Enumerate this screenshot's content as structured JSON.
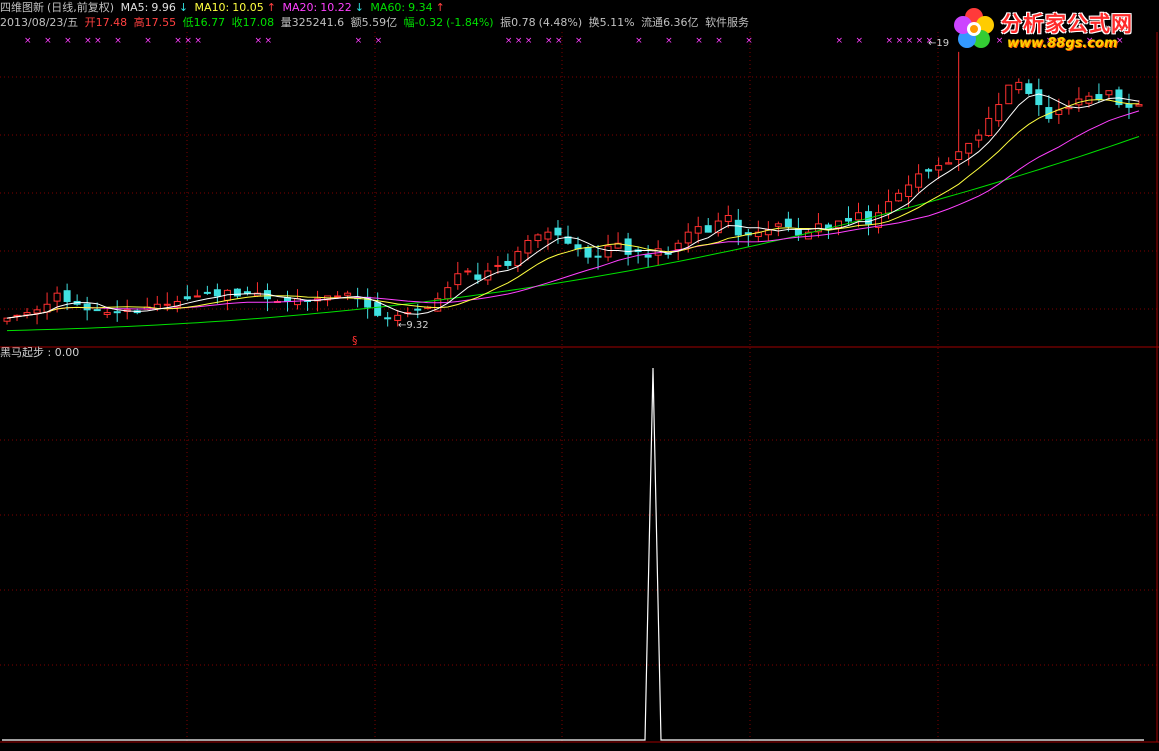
{
  "header": {
    "title": "四维图新",
    "mode": "(日线,前复权)",
    "ma": [
      {
        "label": "MA5:",
        "value": "9.96",
        "arrow": "↓",
        "color": "#e0e0e0"
      },
      {
        "label": "MA10:",
        "value": "10.05",
        "arrow": "↑",
        "color": "#ffff40"
      },
      {
        "label": "MA20:",
        "value": "10.22",
        "arrow": "↓",
        "color": "#ff40ff"
      },
      {
        "label": "MA60:",
        "value": "9.34",
        "arrow": "↑",
        "color": "#00e000"
      }
    ],
    "quote": {
      "date": "2013/08/23/五",
      "open_label": "开",
      "open": "17.48",
      "high_label": "高",
      "high": "17.55",
      "low_label": "低",
      "low": "16.77",
      "close_label": "收",
      "close": "17.08",
      "volume_label": "量",
      "volume": "325241.6",
      "amount_label": "额",
      "amount": "5.59亿",
      "change_label": "幅",
      "change": "-0.32",
      "change_pct": "(-1.84%)",
      "amplitude_label": "振",
      "amplitude": "0.78",
      "amplitude_pct": "(4.48%)",
      "turnover_label": "换",
      "turnover": "5.11%",
      "float_label": "流通",
      "float_cap": "6.36亿",
      "sector": "软件服务"
    }
  },
  "logo": {
    "brand": "分析家公式网",
    "url": "www.88gs.com"
  },
  "price_labels": {
    "high_mark": "19",
    "low_mark": "9.32"
  },
  "indicator": {
    "name": "黑马起步",
    "sep": ":",
    "value": "0.00",
    "signal_glyph": "§"
  },
  "colors": {
    "up": "#ff3030",
    "down": "#40e0e0",
    "ma5": "#ffffff",
    "ma10": "#ffff40",
    "ma20": "#ff40ff",
    "ma60": "#00e000",
    "grid": "#800000",
    "xmark": "#ff40ff"
  },
  "chart_data": {
    "type": "candlestick",
    "series_count": 114,
    "closes": [
      9.4,
      9.5,
      9.6,
      9.7,
      9.9,
      10.3,
      10.0,
      9.9,
      9.7,
      9.7,
      9.6,
      9.6,
      9.7,
      9.6,
      9.8,
      9.9,
      9.9,
      10.0,
      10.1,
      10.2,
      10.3,
      10.2,
      10.4,
      10.2,
      10.3,
      10.3,
      10.1,
      10.0,
      10.0,
      10.1,
      10.0,
      10.1,
      10.2,
      10.2,
      10.3,
      10.1,
      9.8,
      9.5,
      9.4,
      9.5,
      9.6,
      9.7,
      9.8,
      10.1,
      10.5,
      11.0,
      11.1,
      10.8,
      11.1,
      11.3,
      11.3,
      11.8,
      12.2,
      12.4,
      12.5,
      12.4,
      12.1,
      11.9,
      11.6,
      11.6,
      12.0,
      12.1,
      11.7,
      11.8,
      11.6,
      11.9,
      11.7,
      12.1,
      12.5,
      12.7,
      12.5,
      12.9,
      13.1,
      12.4,
      12.4,
      12.5,
      12.6,
      12.8,
      12.7,
      12.4,
      12.5,
      12.8,
      12.6,
      12.9,
      12.9,
      13.2,
      12.8,
      13.2,
      13.6,
      13.9,
      14.2,
      14.6,
      14.7,
      14.9,
      15.0,
      15.4,
      15.7,
      16.0,
      16.6,
      17.1,
      17.8,
      17.9,
      17.5,
      17.1,
      16.6,
      16.9,
      17.0,
      17.3,
      17.4,
      17.3,
      17.6,
      17.1,
      17.0,
      17.1
    ]
  },
  "pane_b": {
    "spike_at": 0.5
  }
}
